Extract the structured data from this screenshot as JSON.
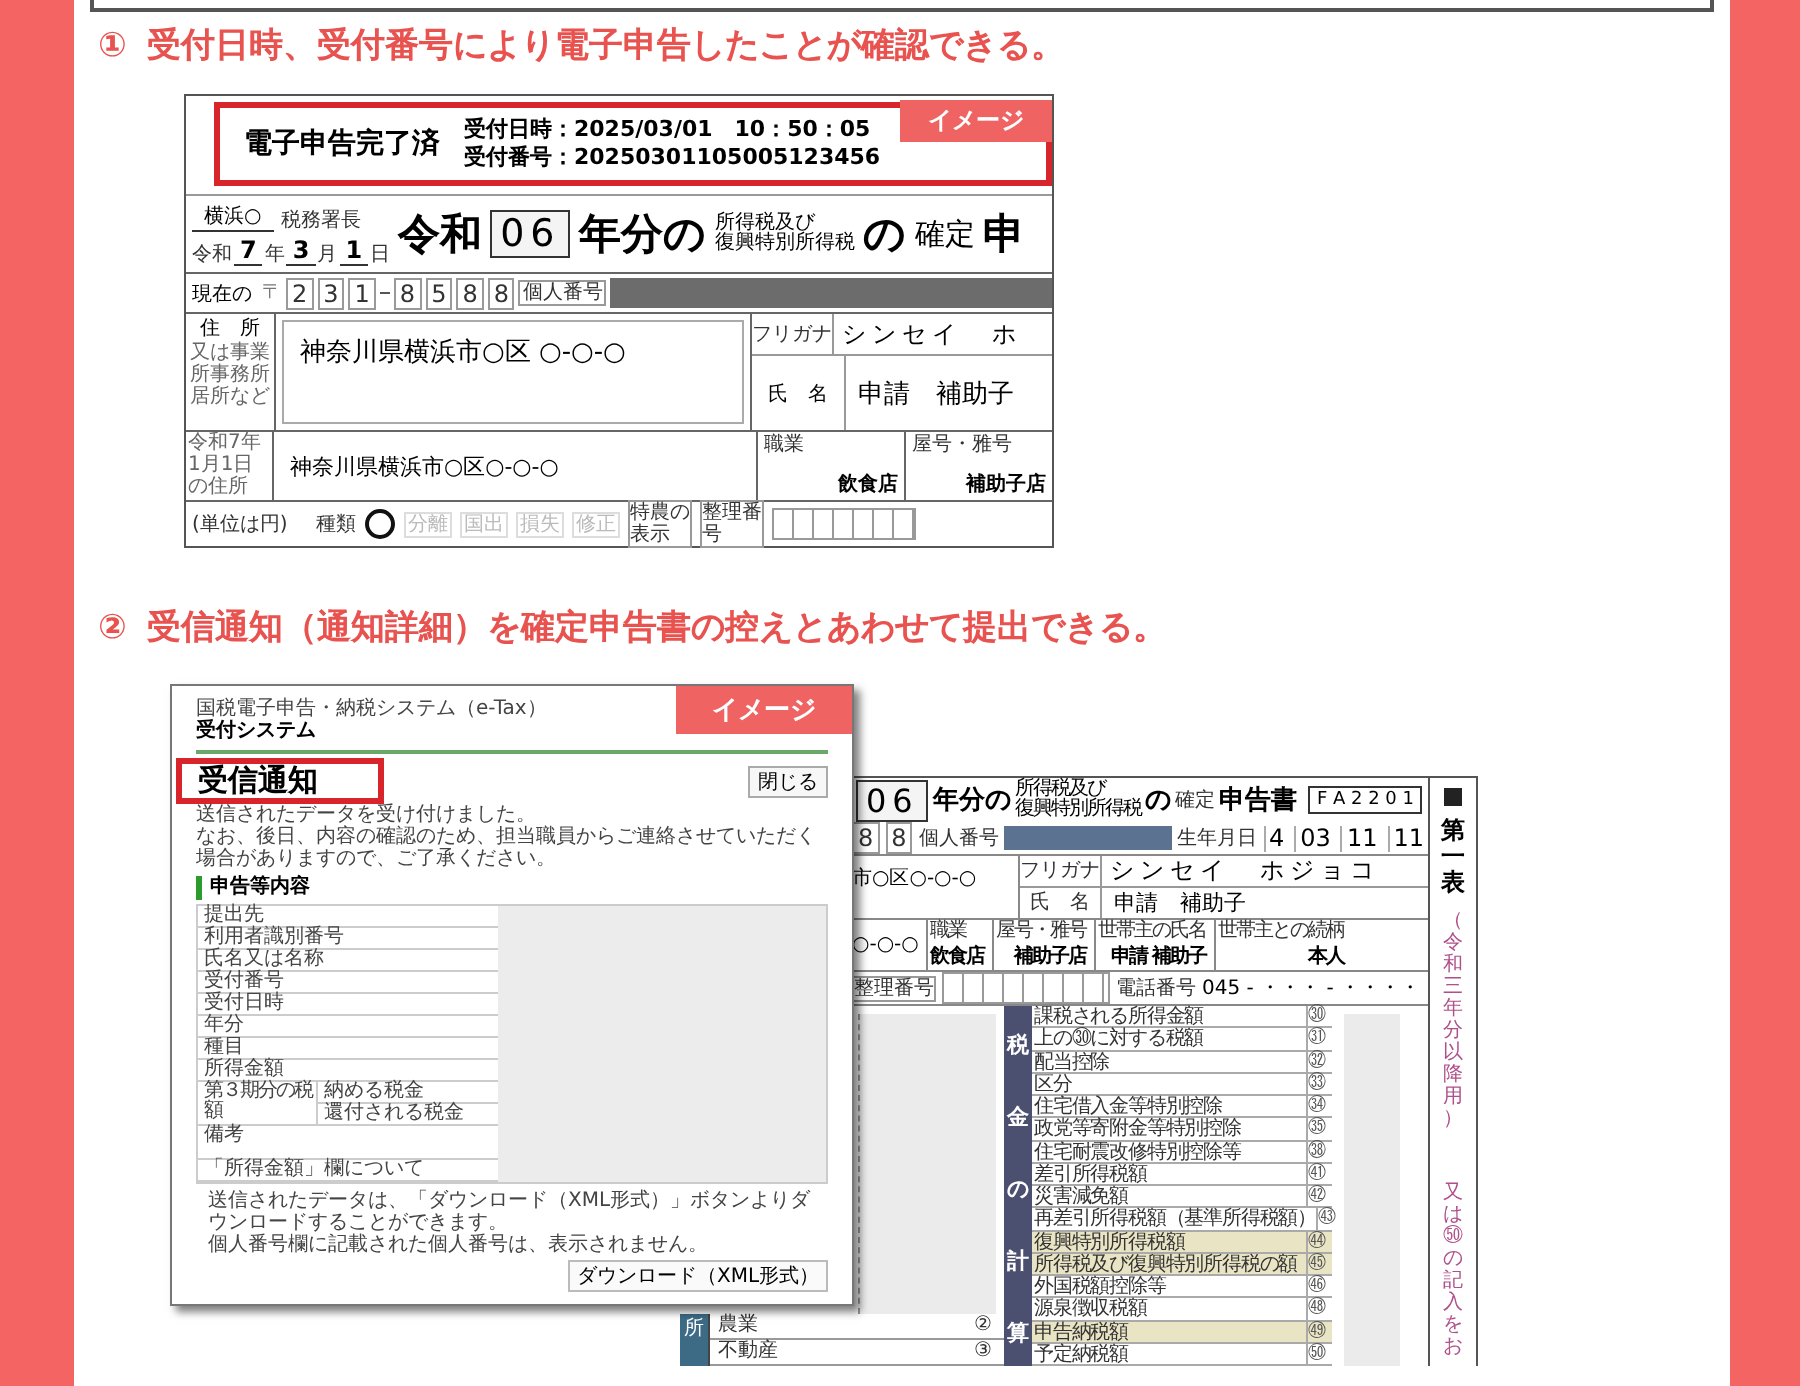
{
  "headings": [
    {
      "number": "①",
      "text": "受付日時、受付番号により電子申告したことが確認できる。"
    },
    {
      "number": "②",
      "text": "受信通知（通知詳細）を確定申告書の控えとあわせて提出できる。"
    }
  ],
  "return_form": {
    "badge": "イメージ",
    "status": "電子申告完了済",
    "receipt_lines": [
      "受付日時：2025/03/01　10：50：05",
      "受付番号：20250301105005123456"
    ],
    "office": "横浜○",
    "office_title": "税務署長",
    "date_parts": [
      {
        "text": "令和",
        "kind": "label"
      },
      {
        "text": "7",
        "kind": "value"
      },
      {
        "text": "年",
        "kind": "label"
      },
      {
        "text": "3",
        "kind": "value"
      },
      {
        "text": "月",
        "kind": "label"
      },
      {
        "text": "1",
        "kind": "value"
      },
      {
        "text": "日",
        "kind": "label"
      }
    ],
    "era": "令和",
    "year_digits": [
      "0",
      "6"
    ],
    "year_suffix": "年分の",
    "tax_name_lines": [
      "所得税及び",
      "復興特別所得税"
    ],
    "particle": "の",
    "kind_label": "確定",
    "title_fragment": "申",
    "address_label": "現在の",
    "postal_mark": "〒",
    "postal_groups": [
      [
        "2",
        "3",
        "1"
      ],
      [
        "8",
        "5",
        "8",
        "8"
      ]
    ],
    "my_number_label": "個人番号",
    "address_labels": [
      "住　所",
      "又は事業所事務所居所など"
    ],
    "address": "神奈川県横浜市○区 ○-○-○",
    "furigana_label": "フリガナ",
    "furigana": "シンセイ　ホ",
    "name_label": "氏　名",
    "name": "申請　補助子",
    "prior_address_label": "令和7年1月1日の住所",
    "prior_address": "神奈川県横浜市○区○-○-○",
    "occupation_label": "職業",
    "occupation": "飲食店",
    "shop_label": "屋号・雅号",
    "shop": "補助子店",
    "unit_note": "(単位は円)",
    "type_label": "種類",
    "faint_options": [
      "分離",
      "国出",
      "損失",
      "修正"
    ],
    "special_label": "特農の表示",
    "reference_label": "整理番号"
  },
  "notice_window": {
    "system": "国税電子申告・納税システム（e-Tax）",
    "subsystem": "受付システム",
    "badge": "イメージ",
    "title": "受信通知",
    "close": "閉じる",
    "messages": [
      "送信されたデータを受け付けました。",
      "なお、後日、内容の確認のため、担当職員からご連絡させていただく場合がありますので、ご了承ください。"
    ],
    "section": "申告等内容",
    "rows": [
      {
        "label": "提出先",
        "kind": "plain"
      },
      {
        "label": "利用者識別番号",
        "kind": "plain"
      },
      {
        "label": "氏名又は名称",
        "kind": "plain"
      },
      {
        "label": "受付番号",
        "kind": "plain"
      },
      {
        "label": "受付日時",
        "kind": "plain"
      },
      {
        "label": "年分",
        "kind": "plain"
      },
      {
        "label": "種目",
        "kind": "plain"
      },
      {
        "label": "所得金額",
        "kind": "plain"
      },
      {
        "label": "第３期分の税額",
        "kind": "split",
        "sublabels": [
          "納める税金",
          "還付される税金"
        ]
      },
      {
        "label": "備考",
        "kind": "tall"
      },
      {
        "label": "「所得金額」欄について",
        "kind": "plain"
      }
    ],
    "footer": [
      "送信されたデータは、「ダウンロード（XML形式）」ボタンよりダウンロードすることができます。",
      "個人番号欄に記載された個人番号は、表示されません。"
    ],
    "download": "ダウンロード（XML形式）"
  },
  "form_copy": {
    "year_digits": [
      "0",
      "6"
    ],
    "year_suffix": "年分の",
    "tax_name_lines": [
      "所得税及び",
      "復興特別所得税"
    ],
    "particle": "の",
    "kind_label": "確定",
    "title": "申告書",
    "form_code": "F A 2 2 0 1",
    "digits_tail": [
      "8",
      "8"
    ],
    "my_number_label": "個人番号",
    "birth_label": "生年月日",
    "birth": [
      "4",
      "03",
      "11",
      "11"
    ],
    "address_fragment": "市○区○-○-○",
    "furigana_label": "フリガナ",
    "furigana": "シンセイ　ホジョコ",
    "name_label": "氏　名",
    "name": "申請　補助子",
    "prior_fragment": "○-○-○",
    "info_cells": [
      {
        "label": "職業",
        "value": "飲食店"
      },
      {
        "label": "屋号・雅号",
        "value": "補助子店"
      },
      {
        "label": "世帯主の氏名",
        "value": "申請 補助子"
      },
      {
        "label": "世帯主との続柄",
        "value": "本人"
      }
    ],
    "reference_label": "整理番号",
    "phone_label": "電話番号",
    "phone": "045 - ・・・ - ・・・・",
    "calc_band": "税金の計算",
    "calc_rows": [
      {
        "label": "課税される所得金額",
        "num": "㉚",
        "shaded": false
      },
      {
        "label": "上の㉚に対する税額",
        "num": "㉛",
        "shaded": false
      },
      {
        "label": "配当控除",
        "num": "㉜",
        "shaded": false
      },
      {
        "label": "区分",
        "num": "㉝",
        "shaded": false
      },
      {
        "label": "住宅借入金等特別控除",
        "num": "㉞",
        "shaded": false
      },
      {
        "label": "政党等寄附金等特別控除",
        "num": "㉟",
        "shaded": false
      },
      {
        "label": "住宅耐震改修特別控除等",
        "num": "㊳",
        "shaded": false
      },
      {
        "label": "差引所得税額",
        "num": "㊶",
        "shaded": false
      },
      {
        "label": "災害減免額",
        "num": "㊷",
        "shaded": false
      },
      {
        "label": "再差引所得税額（基準所得税額）",
        "num": "㊸",
        "shaded": false
      },
      {
        "label": "復興特別所得税額",
        "num": "㊹",
        "shaded": true
      },
      {
        "label": "所得税及び復興特別所得税の額",
        "num": "㊺",
        "shaded": true
      },
      {
        "label": "外国税額控除等",
        "num": "㊻",
        "shaded": false
      },
      {
        "label": "源泉徴収税額",
        "num": "㊽",
        "shaded": false
      },
      {
        "label": "申告納税額",
        "num": "㊾",
        "shaded": true
      },
      {
        "label": "予定納税額",
        "num": "㊿",
        "shaded": false
      }
    ],
    "income_band": "所",
    "income_rows": [
      {
        "label": "農業",
        "num": "②"
      },
      {
        "label": "不動産",
        "num": "③"
      }
    ],
    "sheet_label": "第一表",
    "sheet_note": "（令和三年分以降用）",
    "side_note": "又は㊿の記入をお"
  }
}
